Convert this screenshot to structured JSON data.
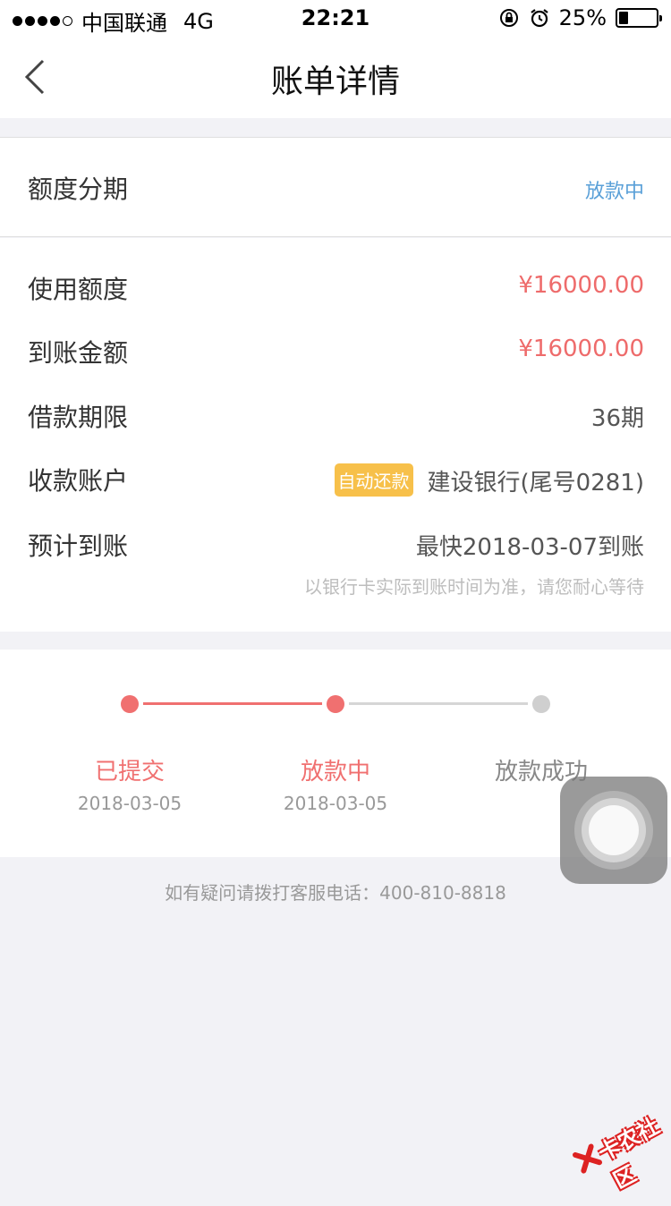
{
  "status_bar": {
    "carrier": "中国联通",
    "network": "4G",
    "time": "22:21",
    "battery_text": "25%",
    "battery_level": 0.25
  },
  "nav": {
    "title": "账单详情"
  },
  "bill_type": {
    "label": "额度分期",
    "status": "放款中"
  },
  "details": {
    "rows": [
      {
        "label": "使用额度",
        "value": "¥16000.00"
      },
      {
        "label": "到账金额",
        "value": "¥16000.00"
      },
      {
        "label": "借款期限",
        "value": "36期"
      },
      {
        "label": "收款账户",
        "badge": "自动还款",
        "value": "建设银行(尾号0281)"
      },
      {
        "label": "预计到账",
        "value": "最快2018-03-07到账"
      }
    ],
    "note": "以银行卡实际到账时间为准，请您耐心等待"
  },
  "progress": {
    "steps": [
      {
        "label": "已提交",
        "date": "2018-03-05"
      },
      {
        "label": "放款中",
        "date": "2018-03-05"
      },
      {
        "label": "放款成功",
        "date": ""
      }
    ]
  },
  "help": {
    "text": "如有疑问请拨打客服电话：400-810-8818"
  },
  "watermark": {
    "text": "卡农社区"
  },
  "colors": {
    "accent_red": "#ee6b6b",
    "status_blue": "#5aa0d8",
    "badge_yellow": "#f7c04a"
  }
}
